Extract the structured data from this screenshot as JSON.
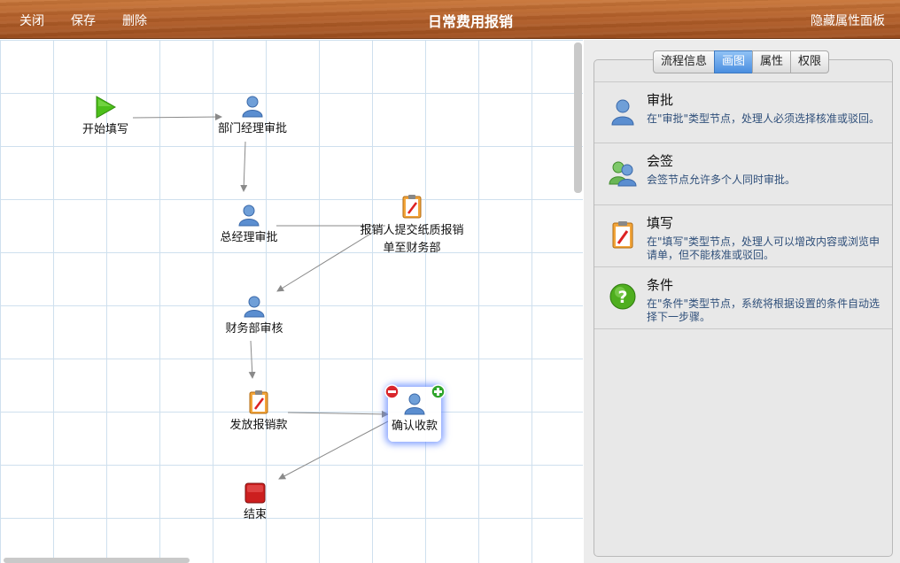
{
  "toolbar": {
    "close": "关闭",
    "save": "保存",
    "delete": "删除",
    "title": "日常费用报销",
    "hide_panel": "隐藏属性面板"
  },
  "flow": {
    "nodes": {
      "start": "开始填写",
      "dept_manager": "部门经理审批",
      "general_manager": "总经理审批",
      "submit_paper_1": "报销人提交纸质报销",
      "submit_paper_2": "单至财务部",
      "finance_review": "财务部审核",
      "payout": "发放报销款",
      "confirm": "确认收款",
      "end": "结束"
    }
  },
  "panel": {
    "tabs": [
      "流程信息",
      "画图",
      "属性",
      "权限"
    ],
    "active_tab": "画图",
    "items": [
      {
        "icon": "user-icon",
        "title": "审批",
        "desc": "在\"审批\"类型节点，处理人必须选择核准或驳回。"
      },
      {
        "icon": "users-icon",
        "title": "会签",
        "desc": "会签节点允许多个人同时审批。"
      },
      {
        "icon": "clipboard-icon",
        "title": "填写",
        "desc": "在\"填写\"类型节点，处理人可以增改内容或浏览申请单，但不能核准或驳回。"
      },
      {
        "icon": "question-icon",
        "title": "条件",
        "desc": "在\"条件\"类型节点，系统将根据设置的条件自动选择下一步骤。"
      }
    ]
  },
  "colors": {
    "header": "#b4602a",
    "grid": "#cfe0ee",
    "active_tab": "#4a8ee0",
    "desc_text": "#2f4f7a"
  }
}
